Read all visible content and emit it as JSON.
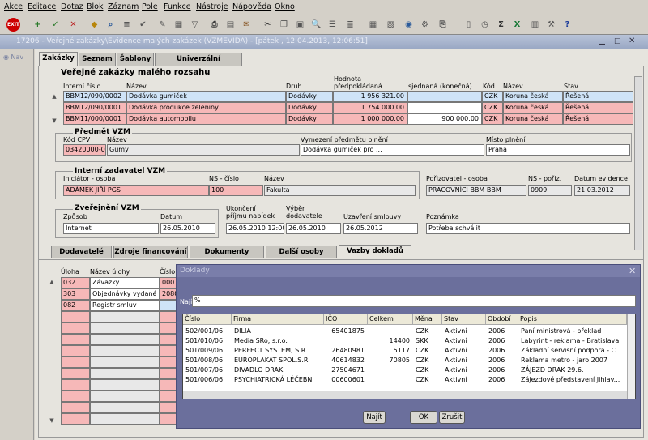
{
  "menu": [
    "Akce",
    "Editace",
    "Dotaz",
    "Blok",
    "Záznam",
    "Pole",
    "Funkce",
    "Nástroje",
    "Nápověda",
    "Okno"
  ],
  "window_title": "17206 - Veřejné zakázky\\Evidence malých zakázek (VZMEVIDA) - [pátek , 12.04.2013, 12:06:51]",
  "nav_label": "Nav",
  "tabs": [
    "Zakázky",
    "Seznam",
    "Šablony",
    "Univerzální náhradníci"
  ],
  "vzm": {
    "title": "Veřejné zakázky malého rozsahu",
    "headers": {
      "interni_cislo": "Interní číslo",
      "nazev": "Název",
      "druh": "Druh",
      "hodnota": "Hodnota",
      "predpokladana": "předpokládaná",
      "sjednana": "sjednaná (konečná)",
      "kod": "Kód",
      "nazev2": "Název",
      "stav": "Stav"
    },
    "rows": [
      {
        "cislo": "BBM12/090/0002",
        "nazev": "Dodávka gumiček",
        "druh": "Dodávky",
        "predp": "1 956 321.00",
        "sjed": "",
        "kod": "CZK",
        "mena": "Koruna česká",
        "stav": "Řešená"
      },
      {
        "cislo": "BBM12/090/0001",
        "nazev": "Dodávka produkce zeleniny",
        "druh": "Dodávky",
        "predp": "1 754 000.00",
        "sjed": "",
        "kod": "CZK",
        "mena": "Koruna česká",
        "stav": "Řešená"
      },
      {
        "cislo": "BBM11/000/0001",
        "nazev": "Dodávka automobilu",
        "druh": "Dodávky",
        "predp": "1 000 000.00",
        "sjed": "900 000.00",
        "kod": "CZK",
        "mena": "Koruna česká",
        "stav": "Řešená"
      }
    ]
  },
  "predmet": {
    "title": "Předmět VZM",
    "kod_label": "Kód CPV",
    "kod": "03420000-0",
    "nazev_label": "Název",
    "nazev": "Gumy",
    "vymezeni_label": "Vymezení předmětu plnění",
    "vymezeni": "Dodávka gumiček pro ...",
    "misto_label": "Místo plnění",
    "misto": "Praha"
  },
  "zadavatel": {
    "title": "Interní zadavatel VZM",
    "iniciator_label": "Iniciátor - osoba",
    "iniciator": "ADÁMEK JIŘÍ PGS",
    "ns_label": "NS - číslo",
    "ns": "100",
    "nazev_label": "Název",
    "nazev": "Fakulta",
    "porizovatel_label": "Pořizovatel - osoba",
    "porizovatel": "PRACOVNÍCI BBM BBM",
    "nsp_label": "NS - pořiz.",
    "nsp": "0909",
    "datum_label": "Datum evidence",
    "datum": "21.03.2012"
  },
  "zverejneni": {
    "title": "Zveřejnění VZM",
    "zpusob_label": "Způsob",
    "zpusob": "Internet",
    "datum_label": "Datum",
    "datum": "26.05.2010",
    "ukonceni_label1": "Ukončení",
    "ukonceni_label2": "příjmu nabídek",
    "ukonceni": "26.05.2010 12:00",
    "vyber_label1": "Výběr",
    "vyber_label2": "dodavatele",
    "vyber": "26.05.2010",
    "uzavreni_label": "Uzavření smlouvy",
    "uzavreni": "26.05.2012",
    "poznamka_label": "Poznámka",
    "poznamka": "Potřeba schválit"
  },
  "subtabs": [
    "Dodavatelé",
    "Zdroje financování",
    "Dokumenty",
    "Další osoby",
    "Vazby dokladů"
  ],
  "vazby": {
    "headers": [
      "Úloha",
      "Název úlohy",
      "Číslo"
    ],
    "rows": [
      {
        "uloha": "032",
        "nazev": "Závazky",
        "cislo": "0001"
      },
      {
        "uloha": "303",
        "nazev": "Objednávky vydané",
        "cislo": "2080"
      },
      {
        "uloha": "082",
        "nazev": "Registr smluv",
        "cislo": ""
      }
    ]
  },
  "dialog": {
    "title": "Doklady",
    "najit_label": "Najít",
    "najit_value": "%",
    "headers": [
      "Číslo",
      "Firma",
      "IČO",
      "Celkem",
      "Měna",
      "Stav",
      "Období",
      "Popis"
    ],
    "rows": [
      [
        "502/001/06",
        "DILIA",
        "65401875",
        "",
        "CZK",
        "Aktivní",
        "2006",
        "Paní ministrová - překlad"
      ],
      [
        "501/010/06",
        "Media SRo, s.r.o.",
        "",
        "14400",
        "SKK",
        "Aktivní",
        "2006",
        "Labyrint - reklama - Bratislava"
      ],
      [
        "501/009/06",
        "PERFECT SYSTEM, S.R. ...",
        "26480981",
        "5117",
        "CZK",
        "Aktivní",
        "2006",
        "Základní servisní podpora - C..."
      ],
      [
        "501/008/06",
        "EUROPLAKAT SPOL.S.R.",
        "40614832",
        "70805",
        "CZK",
        "Aktivní",
        "2006",
        "Reklama metro - jaro 2007"
      ],
      [
        "501/007/06",
        "DIVADLO DRAK",
        "27504671",
        "",
        "CZK",
        "Aktivní",
        "2006",
        "ZÁJEZD DRAK 29.6."
      ],
      [
        "501/006/06",
        "PSYCHIATRICKÁ LÉČEBN",
        "00600601",
        "",
        "CZK",
        "Aktivní",
        "2006",
        "Zájezdové představení Jihlav..."
      ]
    ],
    "buttons": {
      "najit": "Najít",
      "ok": "OK",
      "zrusit": "Zrušit"
    }
  }
}
